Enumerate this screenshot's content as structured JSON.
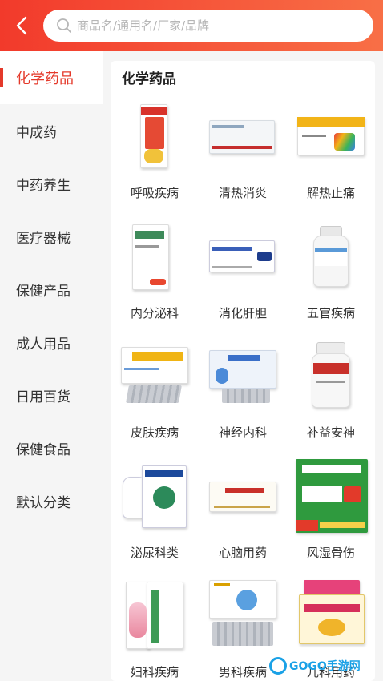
{
  "header": {
    "search_placeholder": "商品名/通用名/厂家/品牌"
  },
  "sidebar": {
    "items": [
      {
        "label": "化学药品",
        "active": true
      },
      {
        "label": "中成药",
        "active": false
      },
      {
        "label": "中药养生",
        "active": false
      },
      {
        "label": "医疗器械",
        "active": false
      },
      {
        "label": "保健产品",
        "active": false
      },
      {
        "label": "成人用品",
        "active": false
      },
      {
        "label": "日用百货",
        "active": false
      },
      {
        "label": "保健食品",
        "active": false
      },
      {
        "label": "默认分类",
        "active": false
      }
    ]
  },
  "main": {
    "title": "化学药品",
    "categories": [
      {
        "label": "呼吸疾病",
        "icon": "cough-syrup-box-image"
      },
      {
        "label": "清热消炎",
        "icon": "tablet-box-image"
      },
      {
        "label": "解热止痛",
        "icon": "tablet-box-image"
      },
      {
        "label": "内分泌科",
        "icon": "tablet-box-image"
      },
      {
        "label": "消化肝胆",
        "icon": "injection-box-image"
      },
      {
        "label": "五官疾病",
        "icon": "pill-bottle-image"
      },
      {
        "label": "皮肤疾病",
        "icon": "granule-box-image"
      },
      {
        "label": "神经内科",
        "icon": "capsule-box-image"
      },
      {
        "label": "补益安神",
        "icon": "pill-bottle-image"
      },
      {
        "label": "泌尿科类",
        "icon": "tablet-box-image"
      },
      {
        "label": "心脑用药",
        "icon": "injection-box-image"
      },
      {
        "label": "风湿骨伤",
        "icon": "tablet-box-image"
      },
      {
        "label": "妇科疾病",
        "icon": "ointment-box-image"
      },
      {
        "label": "男科疾病",
        "icon": "tablet-box-image"
      },
      {
        "label": "儿科用药",
        "icon": "granule-box-image"
      }
    ]
  },
  "watermark": {
    "text": "GOGO手游网"
  },
  "colors": {
    "accent": "#e4392a",
    "header_start": "#f23a2b",
    "header_end": "#f86f46"
  }
}
